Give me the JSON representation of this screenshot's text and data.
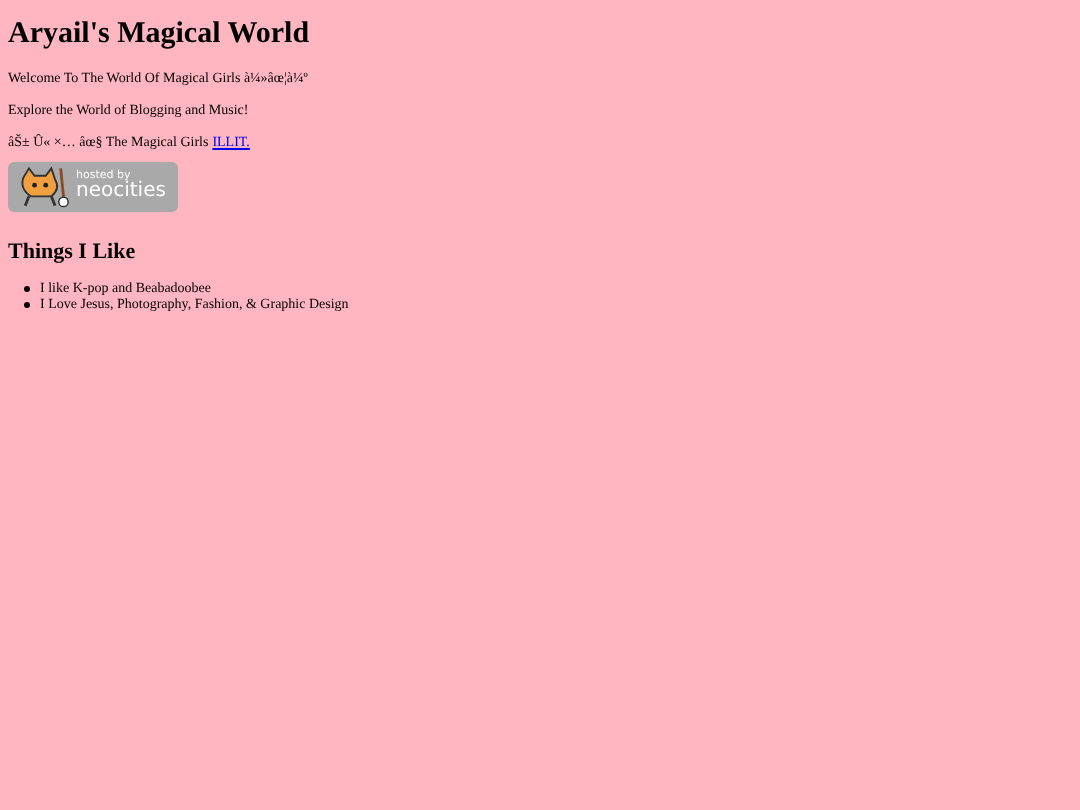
{
  "title": "Aryail's Magical World",
  "paragraphs": [
    {
      "text": "Welcome To The World Of Magical Girls à¼»âœ¦à¼º"
    },
    {
      "text": "Explore the World of Blogging and Music!"
    },
    {
      "text": "âŠ± Û« ×… âœ§ The Magical Girls",
      "link": "ILLIT."
    }
  ],
  "badge": {
    "line1": "hosted by",
    "line2": "neocities"
  },
  "section": {
    "heading": "Things I Like",
    "items": [
      "I like K-pop and Beabadoobee",
      "I Love Jesus, Photography, Fashion, & Graphic Design"
    ]
  }
}
